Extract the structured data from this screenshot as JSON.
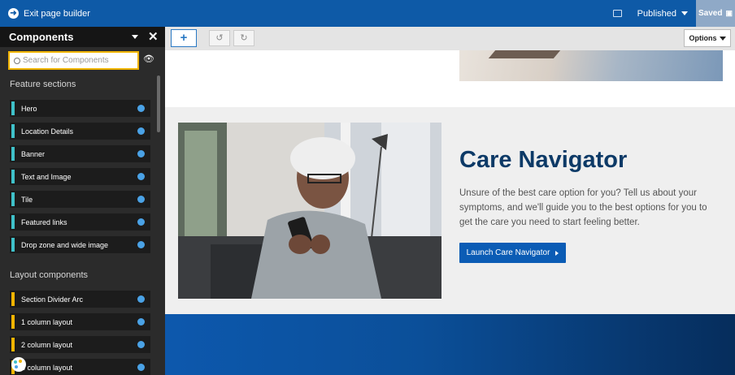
{
  "topbar": {
    "exit_label": "Exit page builder",
    "status_label": "Published",
    "saved_label": "Saved"
  },
  "sidebar": {
    "title": "Components",
    "search_placeholder": "Search for Components",
    "sections": [
      {
        "title": "Feature sections",
        "accent": "#3fc1c9",
        "items": [
          "Hero",
          "Location Details",
          "Banner",
          "Text and Image",
          "Tile",
          "Featured links",
          "Drop zone and wide image"
        ]
      },
      {
        "title": "Layout components",
        "accent": "#f0b400",
        "items": [
          "Section Divider Arc",
          "1 column layout",
          "2 column layout",
          "3 column layout"
        ]
      }
    ]
  },
  "toolbar": {
    "add_symbol": "+",
    "undo_symbol": "↺",
    "redo_symbol": "↻",
    "options_label": "Options"
  },
  "canvas": {
    "care": {
      "title": "Care Navigator",
      "description": "Unsure of the best care option for you? Tell us about your symptoms, and we'll guide you to the best options for you to get the care you need to start feeling better.",
      "button_label": "Launch Care Navigator"
    }
  },
  "colors": {
    "brand": "#0e5aa7",
    "title": "#0d3a67",
    "button": "#0b5cb5"
  }
}
